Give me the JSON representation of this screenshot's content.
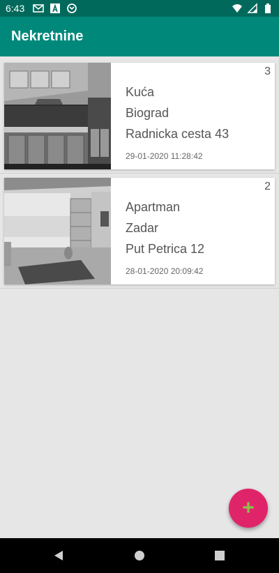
{
  "status_bar": {
    "time": "6:43",
    "left_icons": [
      "gmail-icon",
      "text-a-icon",
      "sync-icon"
    ],
    "right_icons": [
      "wifi-icon",
      "cell-signal-icon",
      "battery-icon"
    ]
  },
  "app_bar": {
    "title": "Nekretnine"
  },
  "listings": [
    {
      "id": "3",
      "type": "Kuća",
      "city": "Biograd",
      "address": "Radnicka cesta 43",
      "date": "29-01-2020 11:28:42",
      "image": "kitchen-photo"
    },
    {
      "id": "2",
      "type": "Apartman",
      "city": "Zadar",
      "address": "Put Petrica 12",
      "date": "28-01-2020 20:09:42",
      "image": "living-room-photo"
    }
  ],
  "fab": {
    "label": "+",
    "icon": "add-icon"
  },
  "nav_bar": {
    "buttons": [
      "back-icon",
      "home-icon",
      "recents-icon"
    ]
  },
  "colors": {
    "status_bar": "#00695c",
    "app_bar": "#00897b",
    "fab": "#e0246a",
    "fab_icon": "#8bc34a",
    "background": "#e6e6e6"
  }
}
